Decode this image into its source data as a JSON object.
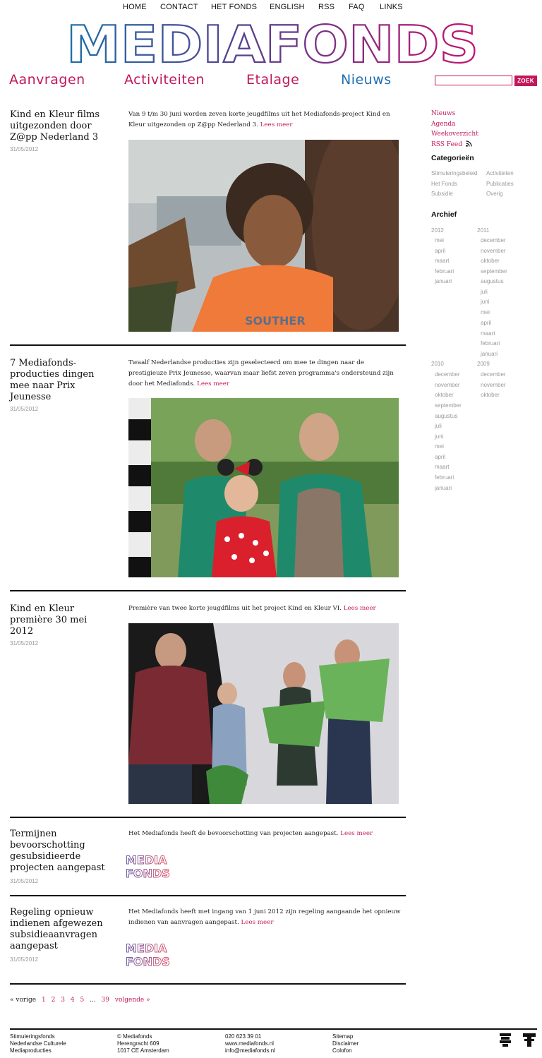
{
  "topnav": [
    "HOME",
    "CONTACT",
    "HET FONDS",
    "ENGLISH",
    "RSS",
    "FAQ",
    "LINKS"
  ],
  "logo_text": "MEDIAFONDS",
  "sections": [
    {
      "label": "Aanvragen",
      "color": "#c2185b"
    },
    {
      "label": "Activiteiten",
      "color": "#c2185b"
    },
    {
      "label": "Etalage",
      "color": "#c2185b"
    },
    {
      "label": "Nieuws",
      "color": "#1f6fb2"
    }
  ],
  "search": {
    "placeholder": "",
    "button": "ZOEK"
  },
  "articles": [
    {
      "title": "Kind en Kleur films uitgezonden door Z@pp Nederland 3",
      "date": "31/05/2012",
      "summary": "Van 9 t/m 30 juni worden zeven korte jeugdfilms uit het Mediafonds-project Kind en Kleur uitgezonden op Z@pp Nederland 3.",
      "more": "Lees meer"
    },
    {
      "title": "7 Mediafonds-producties dingen mee naar Prix Jeunesse",
      "date": "31/05/2012",
      "summary": "Twaalf Nederlandse producties zijn geselecteerd om mee te dingen naar de prestigieuze Prix Jeunesse, waarvan maar liefst zeven programma's ondersteund zijn door het Mediafonds.",
      "more": "Lees meer"
    },
    {
      "title": "Kind en Kleur première 30 mei 2012",
      "date": "31/05/2012",
      "summary": "Première van twee korte jeugdfilms uit het project Kind en Kleur VI.",
      "more": "Lees meer"
    },
    {
      "title": "Termijnen bevoorschotting gesubsidieerde projecten aangepast",
      "date": "31/05/2012",
      "summary": "Het Mediafonds heeft de bevoorschotting van projecten aangepast.",
      "more": "Lees meer",
      "logo_lines": [
        "MEDIA",
        "FONDS"
      ]
    },
    {
      "title": "Regeling opnieuw indienen afgewezen subsidieaanvragen aangepast",
      "date": "31/05/2012",
      "summary": "Het Mediafonds heeft met ingang van 1 juni 2012 zijn regeling aangaande het opnieuw indienen van aanvragen aangepast.",
      "more": "Lees meer",
      "logo_lines": [
        "MEDIA",
        "FONDS"
      ]
    }
  ],
  "pagination": {
    "prev": "« vorige",
    "pages": [
      "1",
      "2",
      "3",
      "4",
      "5"
    ],
    "ellipsis": "...",
    "last": "39",
    "next": "volgende »"
  },
  "sidebar": {
    "links": [
      "Nieuws",
      "Agenda",
      "Weekoverzicht",
      "RSS Feed"
    ],
    "categories_title": "Categorieën",
    "categories": [
      "Stimuleringsbeleid",
      "Activiteiten",
      "Het Fonds",
      "Publicaties",
      "Subsidie",
      "Overig"
    ],
    "archive_title": "Archief",
    "archive": [
      {
        "year": "2012",
        "months": [
          "mei",
          "april",
          "maart",
          "februari",
          "januari"
        ]
      },
      {
        "year": "2011",
        "months": [
          "december",
          "november",
          "oktober",
          "september",
          "augustus",
          "juli",
          "juni",
          "mei",
          "april",
          "maart",
          "februari",
          "januari"
        ]
      },
      {
        "year": "2010",
        "months": [
          "december",
          "november",
          "oktober",
          "september",
          "augustus",
          "juli",
          "juni",
          "mei",
          "april",
          "maart",
          "februari",
          "januari"
        ]
      },
      {
        "year": "2009",
        "months": [
          "december",
          "november",
          "oktober"
        ]
      }
    ]
  },
  "footer": {
    "col1": [
      "Stimuleringsfonds",
      "Nederlandse Culturele",
      "Mediaproducties"
    ],
    "col2": [
      "© Mediafonds",
      "Herengracht 609",
      "1017 CE Amsterdam"
    ],
    "col3": [
      "020 623 39 01",
      "www.mediafonds.nl",
      "info@mediafonds.nl"
    ],
    "col4": [
      "Sitemap",
      "Disclaimer",
      "Colofon"
    ]
  },
  "colors": {
    "accent": "#c2185b",
    "nieuws": "#1f6fb2",
    "text": "#111111",
    "muted": "#999999"
  }
}
